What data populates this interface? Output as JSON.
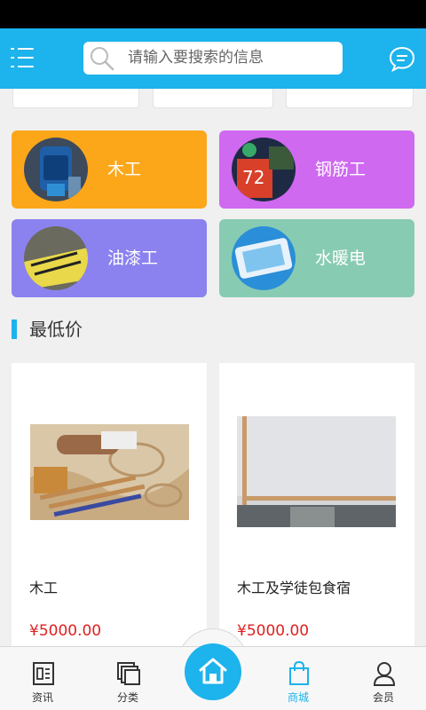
{
  "search": {
    "placeholder": "请输入要搜索的信息"
  },
  "categories": [
    {
      "label": "木工",
      "color": "#fca71a"
    },
    {
      "label": "钢筋工",
      "color": "#cf69f0"
    },
    {
      "label": "油漆工",
      "color": "#8b82f0"
    },
    {
      "label": "水暖电",
      "color": "#88cbb3"
    }
  ],
  "section": {
    "title": "最低价"
  },
  "products": [
    {
      "name": "木工",
      "price": "¥5000.00"
    },
    {
      "name": "木工及学徒包食宿",
      "price": "¥5000.00"
    }
  ],
  "tabs": [
    {
      "label": "资讯",
      "icon": "news-icon"
    },
    {
      "label": "分类",
      "icon": "category-icon"
    },
    {
      "label": "",
      "icon": "home-icon"
    },
    {
      "label": "商城",
      "icon": "shopping-bag-icon",
      "active": true
    },
    {
      "label": "会员",
      "icon": "member-icon"
    }
  ],
  "colors": {
    "accent": "#1db3ec",
    "price": "#e02020"
  }
}
